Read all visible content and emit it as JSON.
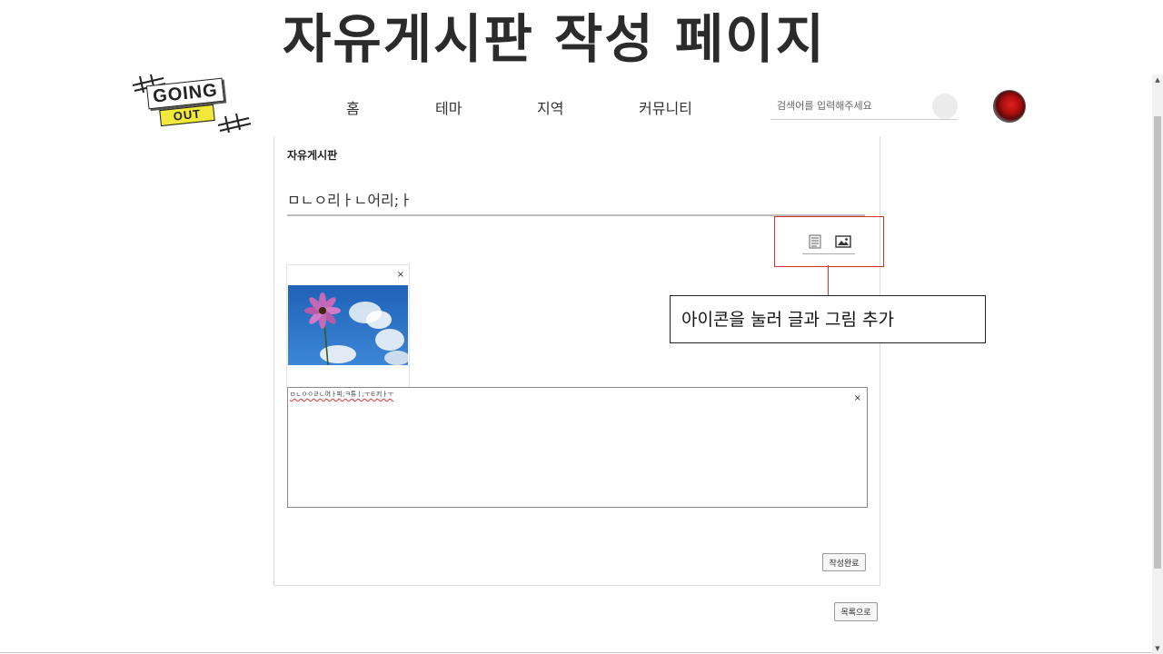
{
  "page_title": "자유게시판 작성 페이지",
  "logo": {
    "top_text": "GOING",
    "bottom_text": "OUT"
  },
  "nav": {
    "items": [
      {
        "label": "홈"
      },
      {
        "label": "테마"
      },
      {
        "label": "지역"
      },
      {
        "label": "커뮤니티"
      }
    ],
    "search_placeholder": "검색어를 입력해주세요"
  },
  "form": {
    "board_label": "자유게시판",
    "title_value": "ㅁㄴㅇ리ㅏㄴ어리;ㅏ",
    "toolbar": {
      "text_icon": "text-block-icon",
      "image_icon": "image-icon"
    },
    "image_block": {
      "close_label": "×"
    },
    "text_block": {
      "value": "ㅁㄴㅇㅇㄹㄴ어ㅏ피;ㅋ튜ㅣ;ㅜㅌ키ㅏㅜ",
      "close_label": "×"
    },
    "submit_label": "작성완료"
  },
  "list_button_label": "목록으로",
  "annotation": {
    "note": "아이콘을 눌러 글과 그림 추가",
    "color": "#d32f2f"
  }
}
